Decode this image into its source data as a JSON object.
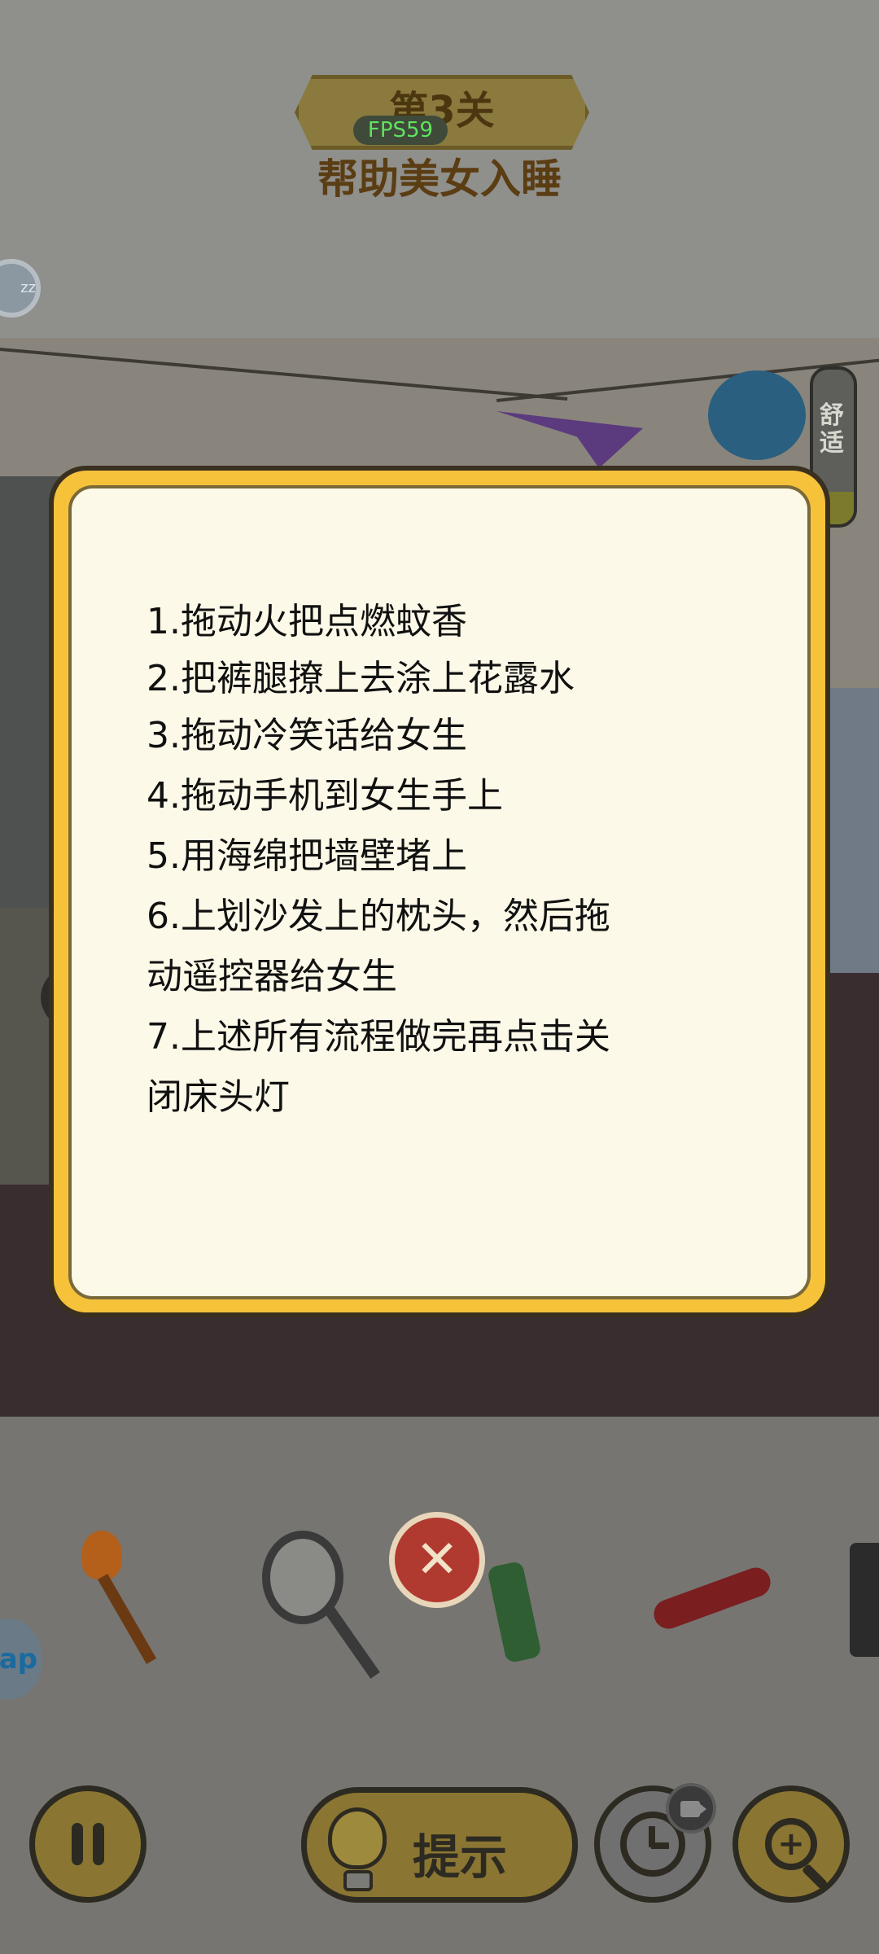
{
  "header": {
    "level": "第3关",
    "fps": "FPS59",
    "title": "帮助美女入睡",
    "zz_badge": "zz"
  },
  "scene": {
    "comfort_meter_label": "舒适"
  },
  "dialog": {
    "instructions": [
      "1.拖动火把点燃蚊香",
      "2.把裤腿撩上去涂上花露水",
      "3.拖动冷笑话给女生",
      "4.拖动手机到女生手上",
      "5.用海绵把墙壁堵上",
      "6.上划沙发上的枕头，然后拖",
      "动遥控器给女生",
      "7.上述所有流程做完再点击关",
      "闭床头灯"
    ]
  },
  "items": {
    "names": [
      "torch-icon",
      "badminton-racket-icon",
      "bottle-icon",
      "scissors-icon",
      "speaker-icon"
    ]
  },
  "side": {
    "app_bubble": "ap"
  },
  "controls": {
    "hint_label": "提示"
  },
  "colors": {
    "dialog_border": "#f6c23a",
    "dialog_bg": "#fdf9e8",
    "close_button": "#b03a30",
    "fps_text": "#5fe35f"
  }
}
